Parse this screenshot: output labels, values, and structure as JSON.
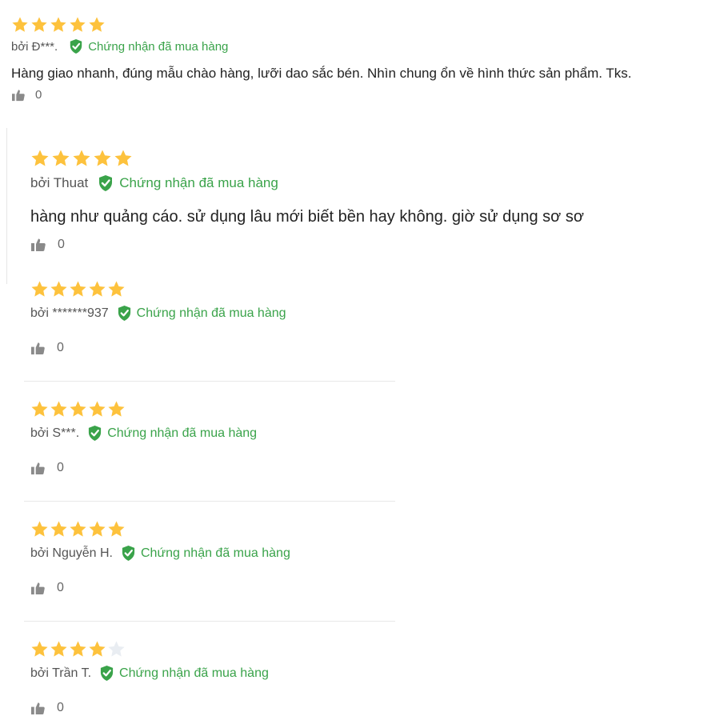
{
  "colors": {
    "star_filled": "#fdc23d",
    "star_empty": "#e9edf2",
    "verified_green": "#3aa34a",
    "text": "#222222",
    "muted": "#666666"
  },
  "icons": {
    "star": "star-icon",
    "verified": "verified-shield-check-icon",
    "like": "thumbs-up-icon"
  },
  "reviews": [
    {
      "rating": 5,
      "max_rating": 5,
      "author": "bởi Đ***.",
      "verified_label": "Chứng nhận đã mua hàng",
      "content": "Hàng giao nhanh, đúng mẫu chào hàng, lưỡi dao sắc bén. Nhìn chung ổn về hình thức sản phẩm. Tks.",
      "likes": "0"
    },
    {
      "rating": 5,
      "max_rating": 5,
      "author": "bởi Thuat",
      "verified_label": "Chứng nhận đã mua hàng",
      "content": "hàng như quảng cáo. sử dụng lâu mới biết bền hay không. giờ sử dụng sơ sơ",
      "likes": "0"
    },
    {
      "rating": 5,
      "max_rating": 5,
      "author": "bởi *******937",
      "verified_label": "Chứng nhận đã mua hàng",
      "content": "",
      "likes": "0"
    },
    {
      "rating": 5,
      "max_rating": 5,
      "author": "bởi S***.",
      "verified_label": "Chứng nhận đã mua hàng",
      "content": "",
      "likes": "0"
    },
    {
      "rating": 5,
      "max_rating": 5,
      "author": "bởi Nguyễn H.",
      "verified_label": "Chứng nhận đã mua hàng",
      "content": "",
      "likes": "0"
    },
    {
      "rating": 4,
      "max_rating": 5,
      "author": "bởi Trần T.",
      "verified_label": "Chứng nhận đã mua hàng",
      "content": "",
      "likes": "0"
    }
  ]
}
